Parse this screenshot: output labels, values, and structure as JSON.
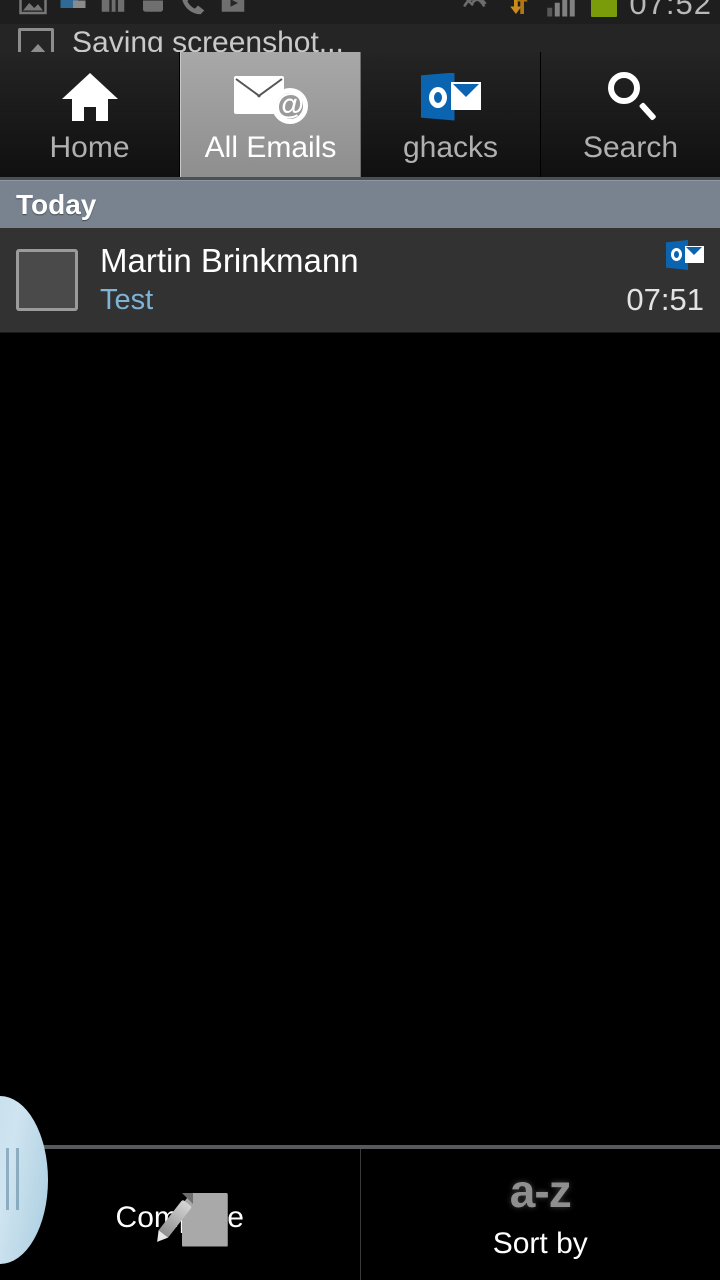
{
  "status_bar": {
    "time": "07:52",
    "icons": [
      "gallery-icon",
      "message-icon",
      "sim-card-icon",
      "android-icon",
      "call-icon",
      "video-icon"
    ],
    "right_icons": [
      "mute-icon",
      "sync-icon",
      "signal-icon"
    ],
    "battery_color": "#7a9b0a"
  },
  "notification": {
    "icon": "screenshot-image-icon",
    "text": "Saving screenshot..."
  },
  "tabs": [
    {
      "label": "Home",
      "icon": "home-icon",
      "active": false
    },
    {
      "label": "All Emails",
      "icon": "envelope-at-icon",
      "active": true
    },
    {
      "label": "ghacks",
      "icon": "outlook-logo-icon",
      "active": false
    },
    {
      "label": "Search",
      "icon": "search-icon",
      "active": false
    }
  ],
  "date_header": {
    "label": "Today"
  },
  "emails": [
    {
      "sender": "Martin Brinkmann",
      "subject": "Test",
      "time": "07:51",
      "account_badge": "outlook-logo-icon",
      "avatar": "empty-avatar-placeholder"
    }
  ],
  "bottom_bar": [
    {
      "label": "Compose",
      "icon": "compose-icon"
    },
    {
      "label": "Sort by",
      "icon": "a-z-icon",
      "glyph": "a-z"
    }
  ],
  "overlay": {
    "name": "floating-handle-bubble",
    "color": "#bcd9e9"
  },
  "colors": {
    "accent_blue": "#7eb4d8",
    "outlook_blue": "#0a64b0",
    "date_header_bg": "#78838f",
    "row_bg": "#323232"
  }
}
